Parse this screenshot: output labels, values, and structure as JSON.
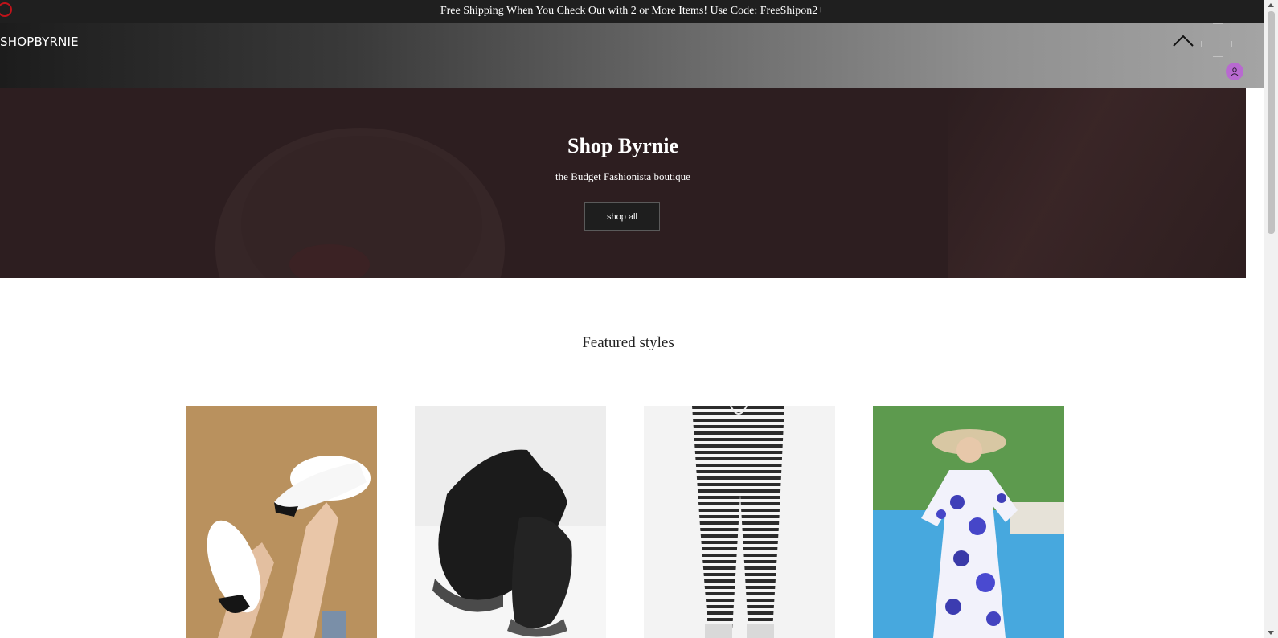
{
  "announcement": {
    "text": "Free Shipping When You Check Out with 2 or More Items! Use Code: FreeShipon2+"
  },
  "header": {
    "logo": "SHOPBYRNIE"
  },
  "hero": {
    "title": "Shop Byrnie",
    "subtitle": "the Budget Fashionista boutique",
    "button_label": "shop all"
  },
  "featured": {
    "title": "Featured styles",
    "products": [
      {
        "image": "white sneakers on tan background"
      },
      {
        "image": "black knit sneakers"
      },
      {
        "image": "black and white striped joggers"
      },
      {
        "image": "blue floral maxi dress by pool"
      }
    ]
  },
  "icons": {
    "collapse": "chevron-up-icon",
    "account": "user-icon",
    "recording": "record-dot-icon"
  },
  "colors": {
    "announce_bg": "#1f1f1f",
    "hero_bg": "#2d1e20",
    "avatar": "#b86ad0",
    "record": "#c0131a"
  }
}
